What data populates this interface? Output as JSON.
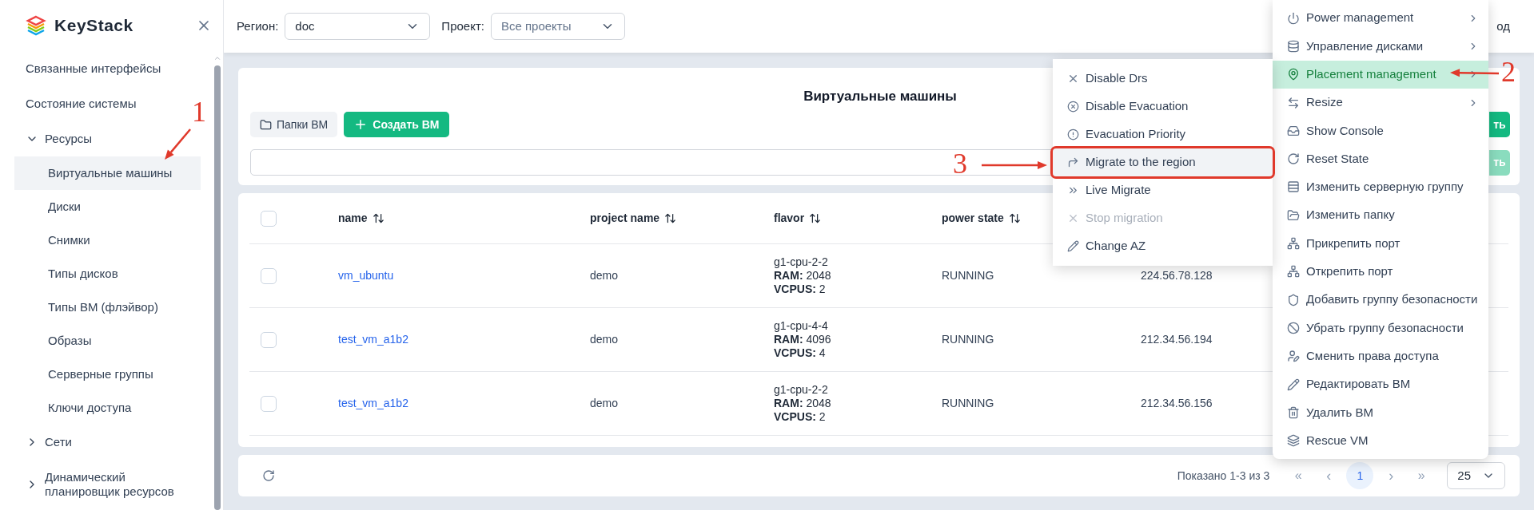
{
  "sidebar": {
    "logo": "KeyStack",
    "items": [
      {
        "label": "Связанные интерфейсы",
        "selected": false
      },
      {
        "label": "Состояние системы",
        "selected": false
      },
      {
        "label": "Ресурсы",
        "expanded": true,
        "selected": false,
        "children": [
          {
            "label": "Виртуальные машины",
            "selected": true
          },
          {
            "label": "Диски",
            "selected": false
          },
          {
            "label": "Снимки",
            "selected": false
          },
          {
            "label": "Типы дисков",
            "selected": false
          },
          {
            "label": "Типы ВМ (флэйвор)",
            "selected": false
          },
          {
            "label": "Образы",
            "selected": false
          },
          {
            "label": "Серверные группы",
            "selected": false
          },
          {
            "label": "Ключи доступа",
            "selected": false
          }
        ]
      },
      {
        "label": "Сети",
        "expanded": false,
        "selected": false
      },
      {
        "label": "Динамический планировщик ресурсов",
        "expanded": false,
        "selected": false
      }
    ]
  },
  "top_bar": {
    "region_label": "Регион:",
    "region_value": "doc",
    "project_label": "Проект:",
    "project_value": "Все проекты",
    "right_text": "од"
  },
  "header": {
    "title": "Виртуальные машины",
    "folders_button": "Папки ВМ",
    "create_button": "Создать ВМ",
    "right_button": "ть",
    "right_button_2": "ть",
    "right_button_2_disabled": true
  },
  "table": {
    "header_checked": false,
    "columns": [
      "name",
      "project name",
      "flavor",
      "power state"
    ],
    "rows": [
      {
        "checked": false,
        "name": "vm_ubuntu",
        "project": "demo",
        "flavor": "g1-cpu-2-2\n**RAM:** 2048\n**VCPUS:** 2",
        "power_state": "RUNNING",
        "column_6": "224.56.78.128"
      },
      {
        "checked": false,
        "name": "test_vm_a1b2",
        "project": "demo",
        "flavor": "g1-cpu-4-4\n**RAM:** 4096\n**VCPUS:** 4",
        "power_state": "RUNNING",
        "column_6": "212.34.56.194"
      },
      {
        "checked": false,
        "name": "test_vm_a1b2",
        "project": "demo",
        "flavor": "g1-cpu-2-2\n**RAM:** 2048\n**VCPUS:** 2",
        "power_state": "RUNNING",
        "column_6": "212.34.56.156"
      }
    ]
  },
  "pagination": {
    "summary": "Показано 1-3 из 3",
    "first": "«",
    "prev": "‹",
    "pages": [
      {
        "label": "1",
        "selected": true
      }
    ],
    "next": "›",
    "last": "»",
    "page_size": "25"
  },
  "context_menu": {
    "items": [
      {
        "label": "Power management",
        "has_submenu": true,
        "selected": false
      },
      {
        "label": "Управление дисками",
        "has_submenu": true,
        "selected": false
      },
      {
        "label": "Placement management",
        "has_submenu": true,
        "selected": true
      },
      {
        "label": "Resize",
        "has_submenu": true,
        "selected": false
      },
      {
        "label": "Show Console",
        "has_submenu": false,
        "selected": false
      },
      {
        "label": "Reset State",
        "has_submenu": false,
        "selected": false
      },
      {
        "label": "Изменить серверную группу",
        "has_submenu": false,
        "selected": false
      },
      {
        "label": "Изменить папку",
        "has_submenu": false,
        "selected": false
      },
      {
        "label": "Прикрепить порт",
        "has_submenu": false,
        "selected": false
      },
      {
        "label": "Открепить порт",
        "has_submenu": false,
        "selected": false
      },
      {
        "label": "Добавить группу безопасности",
        "has_submenu": false,
        "selected": false
      },
      {
        "label": "Убрать группу безопасности",
        "has_submenu": false,
        "selected": false
      },
      {
        "label": "Сменить права доступа",
        "has_submenu": false,
        "selected": false
      },
      {
        "label": "Редактировать ВМ",
        "has_submenu": false,
        "selected": false
      },
      {
        "label": "Удалить ВМ",
        "has_submenu": false,
        "selected": false
      },
      {
        "label": "Rescue VM",
        "has_submenu": false,
        "selected": false
      }
    ]
  },
  "submenu": {
    "items": [
      {
        "label": "Disable Drs",
        "selected": false,
        "disabled": false
      },
      {
        "label": "Disable Evacuation",
        "selected": false,
        "disabled": false
      },
      {
        "label": "Evacuation Priority",
        "selected": false,
        "disabled": false
      },
      {
        "label": "Migrate to the region",
        "selected": true,
        "disabled": false
      },
      {
        "label": "Live Migrate",
        "selected": false,
        "disabled": false
      },
      {
        "label": "Stop migration",
        "selected": false,
        "disabled": true
      },
      {
        "label": "Change AZ",
        "selected": false,
        "disabled": false
      }
    ]
  },
  "annotations": [
    {
      "label": "1"
    },
    {
      "label": "2"
    },
    {
      "label": "3"
    }
  ]
}
